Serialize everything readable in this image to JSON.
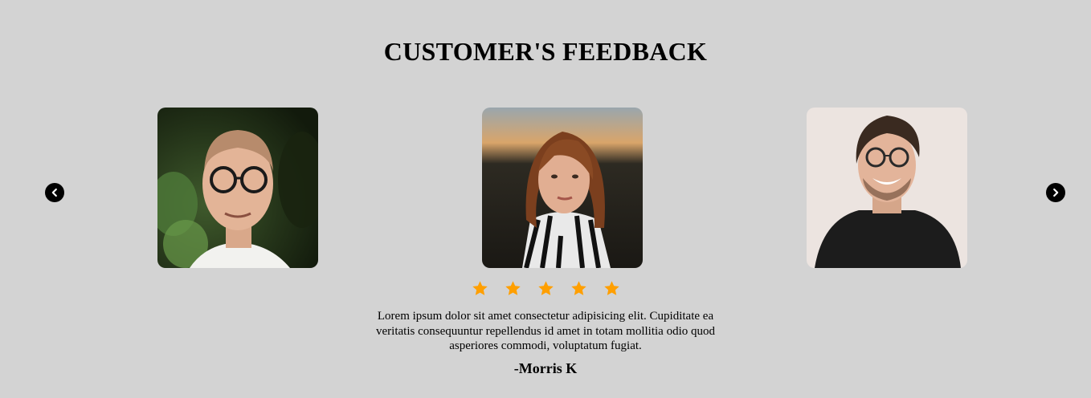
{
  "header": {
    "title": "CUSTOMER'S FEEDBACK"
  },
  "carousel": {
    "prev_icon": "chevron-left-icon",
    "next_icon": "chevron-right-icon",
    "cards": [
      {
        "photo": "man-glasses-outdoor-photo"
      },
      {
        "photo": "woman-striped-shirt-photo"
      },
      {
        "photo": "man-glasses-black-tshirt-photo"
      }
    ]
  },
  "review": {
    "rating": 5,
    "star_color": "#ff9f00",
    "text": "Lorem ipsum dolor sit amet consectetur adipisicing elit. Cupiditate ea veritatis consequuntur repellendus id amet in totam mollitia odio quod asperiores commodi, voluptatum fugiat.",
    "author": "-Morris K"
  },
  "colors": {
    "background": "#d3d3d3",
    "arrow": "#000000"
  }
}
